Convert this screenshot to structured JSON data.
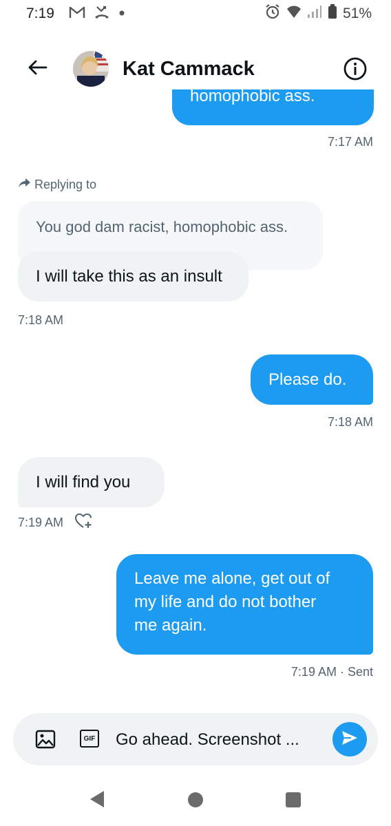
{
  "status_bar": {
    "time": "7:19",
    "battery": "51%",
    "icons": [
      "gmail-icon",
      "missed-call-icon",
      "notification-dot-icon",
      "alarm-icon",
      "wifi-icon",
      "signal-icon",
      "battery-icon"
    ]
  },
  "header": {
    "name": "Kat Cammack",
    "back_icon": "back-arrow-icon",
    "info_icon": "info-icon"
  },
  "messages": {
    "sent_1_partial": "homophobic ass.",
    "sent_1_time": "7:17 AM",
    "replying_label": "Replying to",
    "quoted_text": "You god dam racist, homophobic ass.",
    "recv_1": "I will take this as an insult",
    "recv_1_time": "7:18 AM",
    "sent_2": "Please do.",
    "sent_2_time": "7:18 AM",
    "recv_2": "I will find you",
    "recv_2_time": "7:19 AM",
    "sent_3_line1": "Leave me alone, get out of",
    "sent_3_line2": "my life and do not bother",
    "sent_3_line3": "me again.",
    "sent_3_time": "7:19 AM · Sent"
  },
  "compose": {
    "gif_label": "GIF",
    "draft_text": "Go ahead. Screenshot ..."
  },
  "colors": {
    "accent": "#1d9bf0",
    "received_bubble": "#eff3f4",
    "secondary_text": "#536471"
  }
}
